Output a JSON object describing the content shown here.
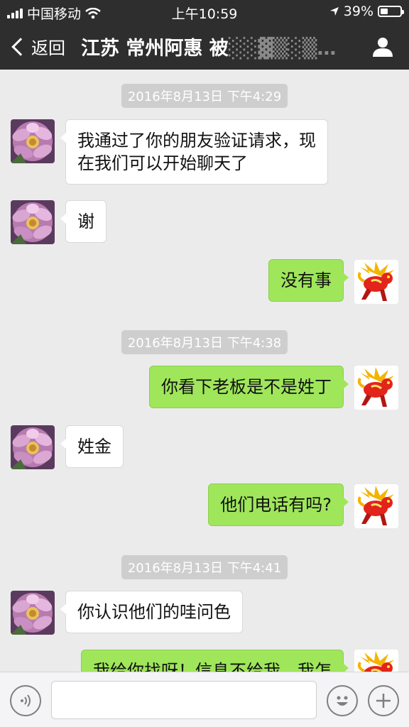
{
  "status_bar": {
    "carrier": "中国移动",
    "time": "上午10:59",
    "battery_text": "39%",
    "battery_level": 0.39
  },
  "nav": {
    "back_label": "返回",
    "title": "江苏 常州阿惠 被",
    "title_obscured": "░░▓▒░▒…"
  },
  "timestamps": [
    "2016年8月13日 下午4:29",
    "2016年8月13日 下午4:38",
    "2016年8月13日 下午4:41"
  ],
  "messages": [
    {
      "side": "in",
      "text_lines": [
        "我通过了你的朋友验证请求，现",
        "在我们可以开始聊天了"
      ]
    },
    {
      "side": "in",
      "text": "谢"
    },
    {
      "side": "out",
      "text": "没有事"
    },
    {
      "side": "out",
      "text": "你看下老板是不是姓丁"
    },
    {
      "side": "in",
      "text": "姓金"
    },
    {
      "side": "out",
      "text": "他们电话有吗?"
    },
    {
      "side": "in",
      "text": "你认识他们的哇问色"
    },
    {
      "side": "out",
      "text": "我给你找呀！信息不给我，我怎"
    }
  ],
  "colors": {
    "header_bg": "#2e2e2e",
    "chat_bg": "#ebebeb",
    "outgoing_bubble": "#9fe65b",
    "incoming_bubble": "#ffffff",
    "timestamp_bg": "#cecece"
  },
  "icons": {
    "signal": "cellular-signal-icon",
    "wifi": "wifi-icon",
    "location": "location-arrow-icon",
    "back": "chevron-left-icon",
    "profile": "person-icon",
    "voice": "voice-input-icon",
    "emoji": "emoji-icon",
    "more": "plus-icon"
  }
}
